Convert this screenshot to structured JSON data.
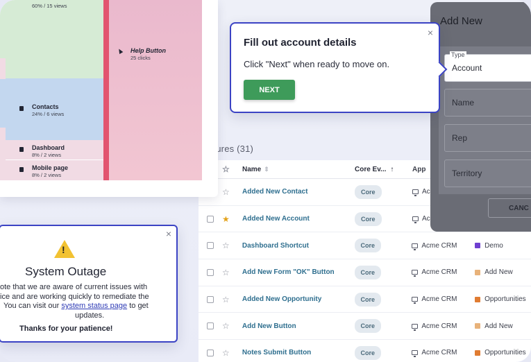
{
  "features": {
    "heading": "atures (31)",
    "columns": {
      "name": "Name",
      "core_events": "Core Ev...",
      "app": "App"
    },
    "rows": [
      {
        "name": "Added New Contact",
        "core": "Core",
        "app": "Ac",
        "category": "",
        "category_color": "",
        "starred": false
      },
      {
        "name": "Added New Account",
        "core": "Core",
        "app": "Ac",
        "category": "",
        "category_color": "",
        "starred": true
      },
      {
        "name": "Dashboard Shortcut",
        "core": "Core",
        "app": "Acme CRM",
        "category": "Demo",
        "category_color": "#6f3fd0",
        "starred": false
      },
      {
        "name": "Add New Form \"OK\" Button",
        "core": "Core",
        "app": "Acme CRM",
        "category": "Add New",
        "category_color": "#e8b27a",
        "starred": false
      },
      {
        "name": "Added New Opportunity",
        "core": "Core",
        "app": "Acme CRM",
        "category": "Opportunities",
        "category_color": "#e07c32",
        "starred": false
      },
      {
        "name": "Add New Button",
        "core": "Core",
        "app": "Acme CRM",
        "category": "Add New",
        "category_color": "#e8b27a",
        "starred": false
      },
      {
        "name": "Notes Submit Button",
        "core": "Core",
        "app": "Acme CRM",
        "category": "Opportunities",
        "category_color": "#e07c32",
        "starred": false
      }
    ]
  },
  "flow": {
    "blocks": [
      {
        "title": "",
        "sub": "60% / 15 views"
      },
      {
        "title": "Contacts",
        "sub": "24% / 6 views"
      },
      {
        "title": "Dashboard",
        "sub": "8% / 2 views"
      },
      {
        "title": "Mobile page",
        "sub": "8% / 2 views"
      }
    ],
    "help": {
      "title": "Help Button",
      "sub": "25 clicks"
    },
    "colors": {
      "green": "#d6ebd5",
      "blue": "#c3d7ef",
      "pink": "#f1dbe4",
      "separator": "#e2546f"
    }
  },
  "tooltip": {
    "title": "Fill out account details",
    "body": "Click \"Next\" when ready to move on.",
    "next": "NEXT",
    "close": "×",
    "accent": "#3b43c4",
    "button_color": "#3e9b5a"
  },
  "drawer": {
    "title": "Add New",
    "type_legend": "Type",
    "type_value": "Account",
    "name_placeholder": "Name",
    "rep_placeholder": "Rep",
    "territory_placeholder": "Territory",
    "cancel": "CANC"
  },
  "outage": {
    "title": "System Outage",
    "close": "×",
    "line1": "ote that we are aware of current issues with",
    "line2": "ice and are working quickly to remediate the",
    "line3_pre": "You can visit our ",
    "link": "system status page",
    "line3_post": " to get",
    "line4": "updates.",
    "thanks": "Thanks for your patience!"
  }
}
